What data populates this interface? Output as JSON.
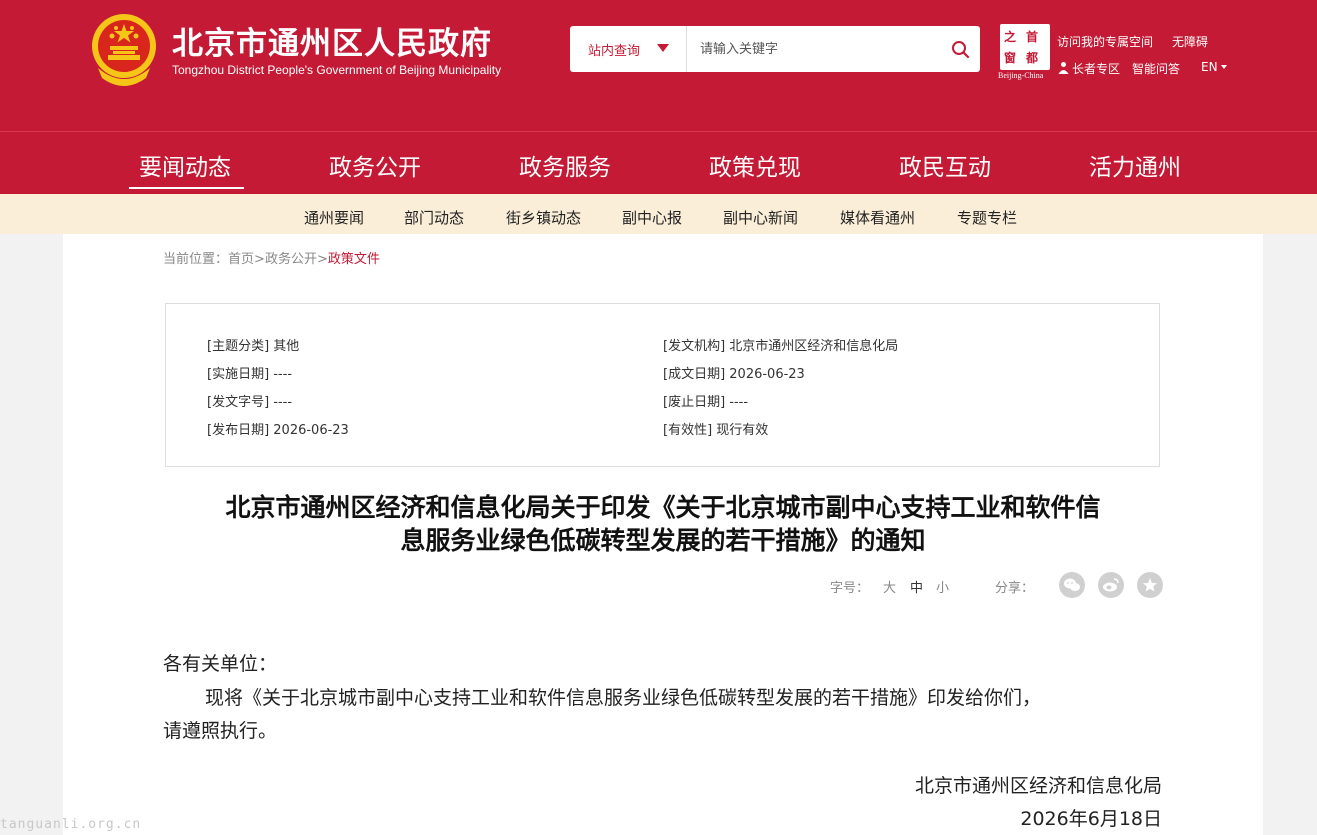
{
  "header": {
    "site_title": "北京市通州区人民政府",
    "site_subtitle": "Tongzhou District People's Government of Beijing Municipality",
    "search": {
      "scope_label": "站内查询",
      "placeholder": "请输入关键字"
    },
    "capital_logo": {
      "chars": [
        "之",
        "首",
        "窗",
        "都"
      ],
      "caption": "Beijing-China"
    },
    "links": {
      "personal_space": "访问我的专属空间",
      "accessibility": "无障碍",
      "elder": "长者专区",
      "smart_qa": "智能问答",
      "lang": "EN"
    }
  },
  "main_nav": [
    {
      "label": "要闻动态",
      "active": true
    },
    {
      "label": "政务公开"
    },
    {
      "label": "政务服务"
    },
    {
      "label": "政策兑现"
    },
    {
      "label": "政民互动"
    },
    {
      "label": "活力通州"
    }
  ],
  "sub_nav": [
    "通州要闻",
    "部门动态",
    "街乡镇动态",
    "副中心报",
    "副中心新闻",
    "媒体看通州",
    "专题专栏"
  ],
  "breadcrumb": {
    "prefix": "当前位置：",
    "items": [
      "首页",
      "政务公开",
      "政策文件"
    ],
    "separator": ">"
  },
  "meta": {
    "topic": "[主题分类] 其他",
    "issuer": "[发文机构] 北京市通州区经济和信息化局",
    "effective_date": "[实施日期] ----",
    "written_date": "[成文日期] 2026-06-23",
    "doc_number": "[发文字号] ----",
    "repeal_date": "[废止日期] ----",
    "publish_date": "[发布日期] 2026-06-23",
    "validity": "[有效性] 现行有效"
  },
  "article": {
    "title_line1": "北京市通州区经济和信息化局关于印发《关于北京城市副中心支持工业和软件信",
    "title_line2": "息服务业绿色低碳转型发展的若干措施》的通知",
    "font_size_label": "字号：",
    "size_large": "大",
    "size_medium": "中",
    "size_small": "小",
    "share_label": "分享：",
    "salutation": "各有关单位：",
    "para_line1": "现将《关于北京城市副中心支持工业和软件信息服务业绿色低碳转型发展的若干措施》印发给你们，",
    "para_line2": "请遵照执行。",
    "sign_org": "北京市通州区经济和信息化局",
    "sign_date": "2026年6月18日"
  },
  "watermark": "tanguanli.org.cn",
  "colors": {
    "brand_red": "#c41a35",
    "subnav_bg": "#faeed8",
    "emblem_gold": "#f5c518"
  }
}
